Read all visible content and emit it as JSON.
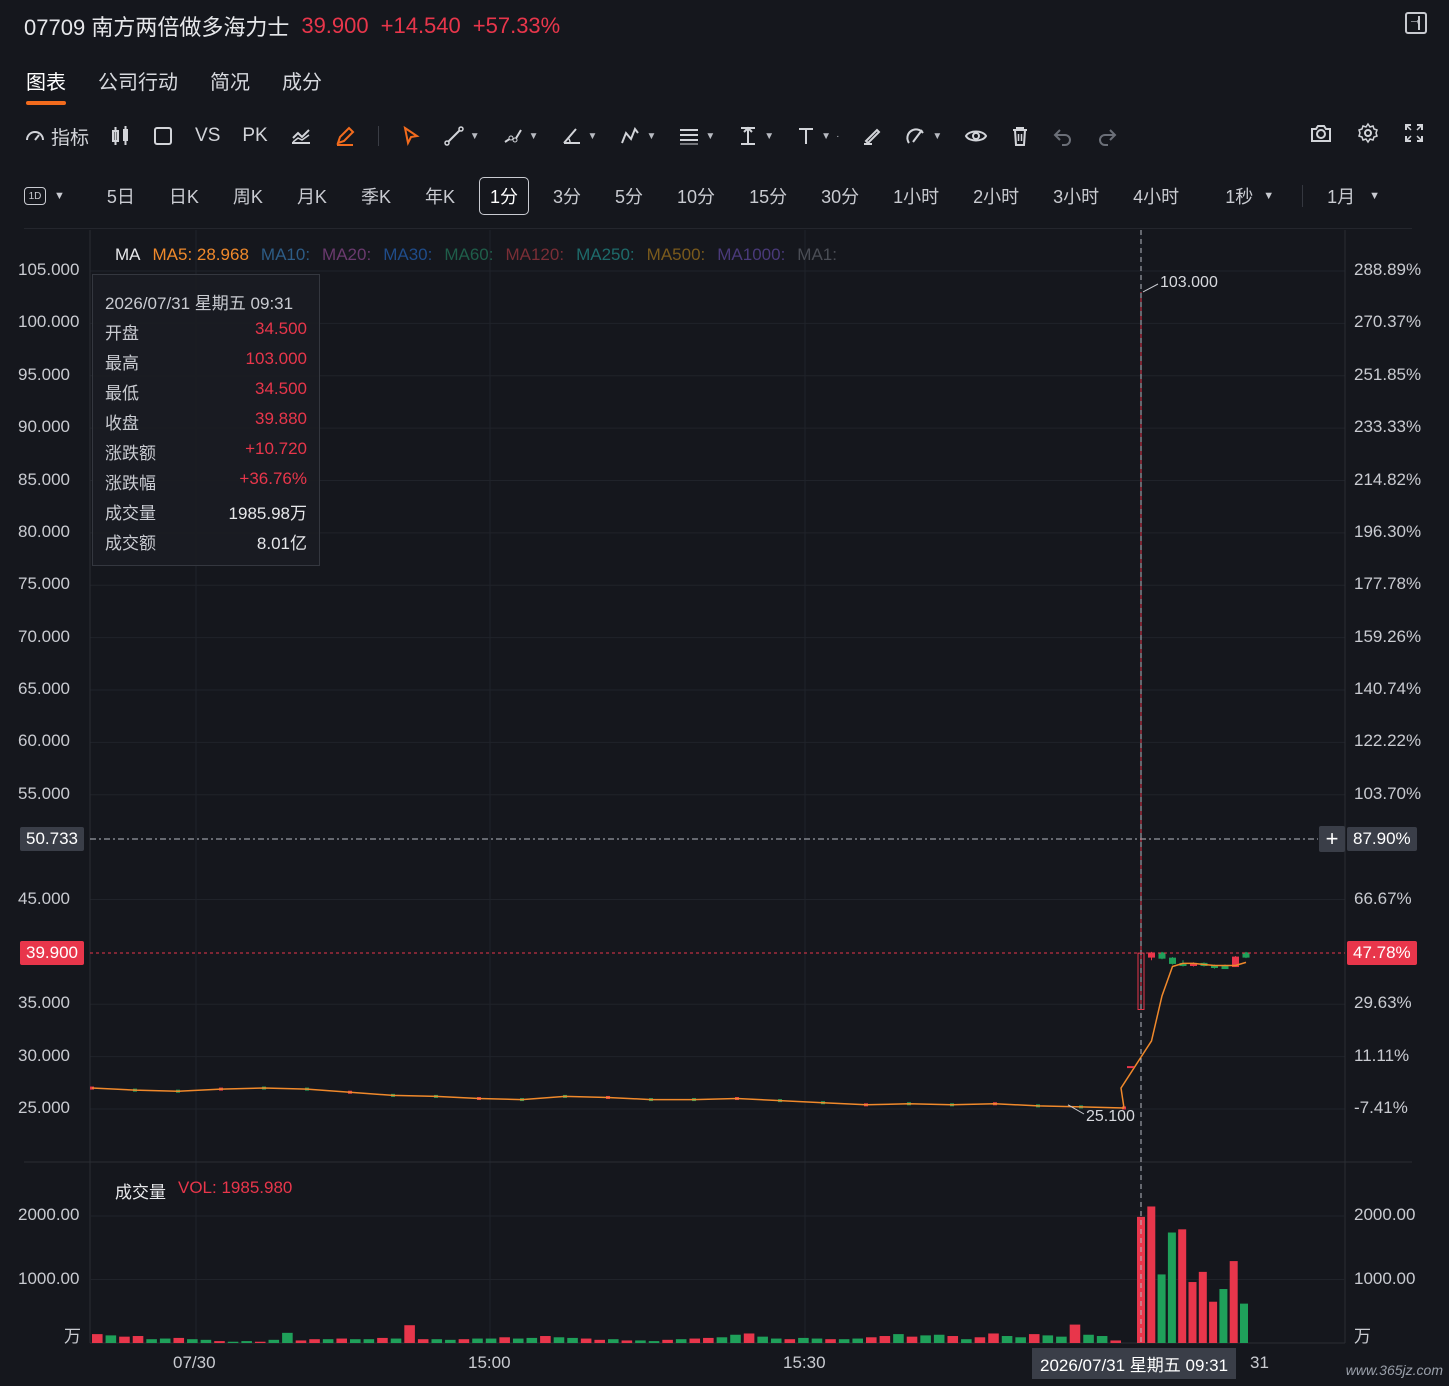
{
  "header": {
    "code": "07709",
    "name": "南方两倍做多海力士",
    "price": "39.900",
    "change": "+14.540",
    "change_pct": "+57.33%",
    "exit_icon": "exit-icon"
  },
  "tabs": [
    {
      "label": "图表",
      "active": true
    },
    {
      "label": "公司行动"
    },
    {
      "label": "简况"
    },
    {
      "label": "成分"
    }
  ],
  "toolbar": {
    "indicator_label": "指标",
    "vs_label": "VS",
    "pk_label": "PK",
    "icons": [
      "gauge-icon",
      "candlestick-icon",
      "square-icon",
      "compare-chart-icon",
      "pencil-icon",
      "cursor-icon",
      "line-icon",
      "path-icon",
      "angle-icon",
      "polyline-icon",
      "fib-icon",
      "measure-icon",
      "text-icon",
      "brush-icon",
      "shape-icon",
      "eye-icon",
      "trash-icon",
      "undo-icon",
      "redo-icon",
      "camera-icon",
      "settings-icon",
      "fullscreen-icon"
    ],
    "accent": "#f26b1d"
  },
  "periods": {
    "badge": "1D",
    "items": [
      "5日",
      "日K",
      "周K",
      "月K",
      "季K",
      "年K",
      "1分",
      "3分",
      "5分",
      "10分",
      "15分",
      "30分",
      "1小时",
      "2小时",
      "3小时",
      "4小时"
    ],
    "active": "1分",
    "seconds": "1秒",
    "range": "1月"
  },
  "ma_legend": {
    "title": "MA",
    "items": [
      {
        "label": "MA5: 28.968",
        "color": "#f0892b"
      },
      {
        "label": "MA10:",
        "color": "#2d5c86"
      },
      {
        "label": "MA20:",
        "color": "#6a3a6e"
      },
      {
        "label": "MA30:",
        "color": "#1f4c8a"
      },
      {
        "label": "MA60:",
        "color": "#1f5e4a"
      },
      {
        "label": "MA120:",
        "color": "#7a2e36"
      },
      {
        "label": "MA250:",
        "color": "#1e6b6b"
      },
      {
        "label": "MA500:",
        "color": "#7a5a1c"
      },
      {
        "label": "MA1000:",
        "color": "#4a3a7a"
      },
      {
        "label": "MA1:",
        "color": "#4a4d55"
      }
    ]
  },
  "tooltip": {
    "datetime": "2026/07/31 星期五 09:31",
    "rows": [
      {
        "k": "开盘",
        "v": "34.500",
        "color": "up"
      },
      {
        "k": "最高",
        "v": "103.000",
        "color": "up"
      },
      {
        "k": "最低",
        "v": "34.500",
        "color": "up"
      },
      {
        "k": "收盘",
        "v": "39.880",
        "color": "up"
      },
      {
        "k": "涨跌额",
        "v": "+10.720",
        "color": "up"
      },
      {
        "k": "涨跌幅",
        "v": "+36.76%",
        "color": "up"
      },
      {
        "k": "成交量",
        "v": "1985.98万",
        "color": "white"
      },
      {
        "k": "成交额",
        "v": "8.01亿",
        "color": "white"
      }
    ]
  },
  "price_axis": {
    "left": [
      "105.000",
      "100.000",
      "95.000",
      "90.000",
      "85.000",
      "80.000",
      "75.000",
      "70.000",
      "65.000",
      "60.000",
      "55.000",
      "45.000",
      "35.000",
      "30.000",
      "25.000"
    ],
    "right": [
      "288.89%",
      "270.37%",
      "251.85%",
      "233.33%",
      "214.82%",
      "196.30%",
      "177.78%",
      "159.26%",
      "140.74%",
      "122.22%",
      "103.70%",
      "66.67%",
      "29.63%",
      "11.11%",
      "-7.41%"
    ],
    "cursor_left": "50.733",
    "cursor_right": "87.90%",
    "last_left": "39.900",
    "last_right": "47.78%",
    "high_label": "103.000",
    "low_label": "25.100"
  },
  "volume": {
    "title": "成交量",
    "vol_label": "VOL: 1985.980",
    "left": [
      "2000.00",
      "1000.00",
      "万"
    ],
    "right": [
      "2000.00",
      "1000.00",
      "万"
    ]
  },
  "x_axis": {
    "labels": [
      "07/30",
      "15:00",
      "15:30",
      "31"
    ],
    "cursor": "2026/07/31 星期五 09:31"
  },
  "watermark": "www.365jz.com",
  "colors": {
    "up": "#e8364b",
    "down": "#1fa05a",
    "ma5": "#f0892b",
    "bg": "#15171d"
  },
  "chart_data": {
    "type": "candlestick",
    "ylim": [
      23.0,
      107.0
    ],
    "volume_ylim": [
      0,
      2300
    ],
    "close_series_pre": [
      27.0,
      26.8,
      26.7,
      26.9,
      27.0,
      26.9,
      26.6,
      26.3,
      26.2,
      26.0,
      25.9,
      26.2,
      26.1,
      25.9,
      25.9,
      26.0,
      25.8,
      25.6,
      25.4,
      25.5,
      25.4,
      25.5,
      25.3,
      25.2,
      25.1
    ],
    "candles_post": [
      {
        "o": 34.5,
        "h": 103.0,
        "l": 34.5,
        "c": 39.88,
        "up": true
      },
      {
        "o": 39.5,
        "h": 40.0,
        "l": 39.2,
        "c": 39.9,
        "up": true
      },
      {
        "o": 39.9,
        "h": 40.0,
        "l": 39.3,
        "c": 39.4,
        "up": false
      },
      {
        "o": 39.4,
        "h": 39.5,
        "l": 38.8,
        "c": 38.9,
        "up": false
      },
      {
        "o": 38.9,
        "h": 39.2,
        "l": 38.6,
        "c": 38.7,
        "up": false
      },
      {
        "o": 38.7,
        "h": 39.0,
        "l": 38.6,
        "c": 38.9,
        "up": true
      },
      {
        "o": 38.9,
        "h": 39.0,
        "l": 38.6,
        "c": 38.7,
        "up": false
      },
      {
        "o": 38.7,
        "h": 38.8,
        "l": 38.4,
        "c": 38.6,
        "up": false
      },
      {
        "o": 38.6,
        "h": 38.8,
        "l": 38.4,
        "c": 38.6,
        "up": false
      },
      {
        "o": 38.6,
        "h": 39.6,
        "l": 38.6,
        "c": 39.5,
        "up": true
      },
      {
        "o": 39.5,
        "h": 40.0,
        "l": 39.4,
        "c": 39.9,
        "up": false
      }
    ],
    "ma5_post": [
      27.0,
      31.5,
      35.8,
      38.6,
      38.9,
      38.9,
      38.8,
      38.7,
      38.7,
      38.7,
      39.0
    ],
    "volume_bars_pre": [
      140,
      120,
      100,
      110,
      60,
      70,
      80,
      60,
      50,
      30,
      20,
      30,
      20,
      50,
      160,
      40,
      60,
      60,
      70,
      60,
      60,
      80,
      70,
      280,
      60,
      60,
      50,
      60,
      70,
      70,
      90,
      70,
      80,
      110,
      90,
      80,
      70,
      50,
      60,
      40,
      40,
      30,
      50,
      60,
      70,
      80,
      90,
      130,
      150,
      100,
      70,
      60,
      80,
      70,
      60,
      60,
      70,
      90,
      110,
      140,
      100,
      120,
      130,
      110,
      60,
      90,
      150,
      110,
      90,
      140,
      120,
      100,
      290,
      130,
      110,
      40
    ],
    "volume_bars_post": [
      {
        "v": 1986,
        "up": true
      },
      {
        "v": 2150,
        "up": true
      },
      {
        "v": 1080,
        "up": false
      },
      {
        "v": 1740,
        "up": false
      },
      {
        "v": 1790,
        "up": true
      },
      {
        "v": 960,
        "up": true
      },
      {
        "v": 1120,
        "up": true
      },
      {
        "v": 650,
        "up": true
      },
      {
        "v": 850,
        "up": false
      },
      {
        "v": 1290,
        "up": true
      },
      {
        "v": 620,
        "up": false
      }
    ]
  }
}
